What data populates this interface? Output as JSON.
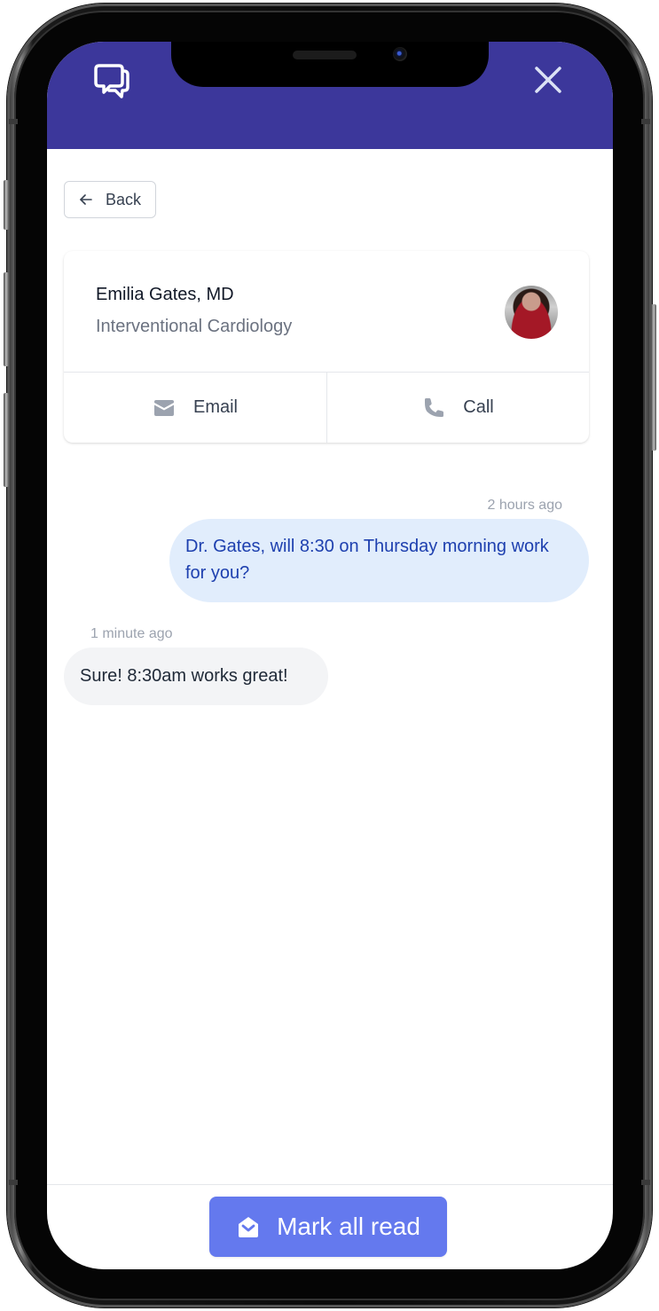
{
  "header": {
    "chat_icon": "chat-bubbles-icon",
    "close_icon": "close-icon",
    "background_color": "#3c379b"
  },
  "back": {
    "label": "Back",
    "icon": "arrow-left-icon"
  },
  "contact": {
    "name": "Emilia Gates, MD",
    "specialty": "Interventional Cardiology",
    "avatar": "contact-avatar-photo",
    "actions": [
      {
        "label": "Email",
        "icon": "envelope-icon"
      },
      {
        "label": "Call",
        "icon": "phone-icon"
      }
    ]
  },
  "messages": [
    {
      "direction": "sent",
      "timestamp": "2 hours ago",
      "text": "Dr. Gates, will 8:30 on Thursday morning work for you?"
    },
    {
      "direction": "received",
      "timestamp": "1 minute ago",
      "text": "Sure! 8:30am works great!"
    }
  ],
  "footer": {
    "mark_all_read_label": "Mark all read",
    "mark_all_read_icon": "envelope-open-icon",
    "button_color": "#6479ee"
  }
}
